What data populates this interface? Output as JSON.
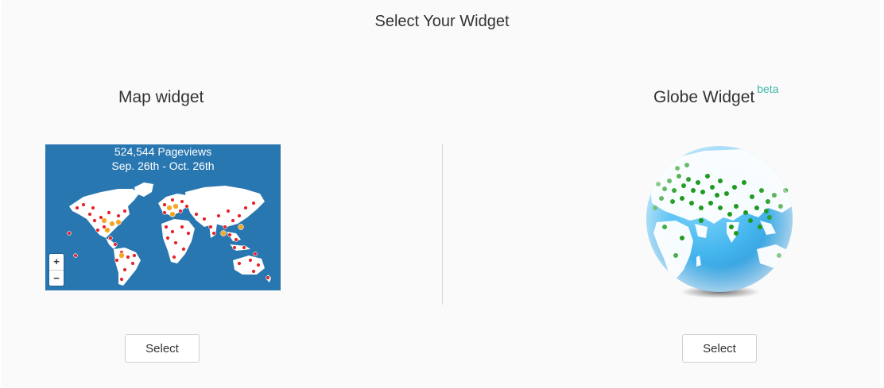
{
  "page": {
    "title": "Select Your Widget"
  },
  "map_widget": {
    "title": "Map widget",
    "stats_line1": "524,544 Pageviews",
    "stats_line2": "Sep. 26th - Oct. 26th",
    "zoom_in": "+",
    "zoom_out": "−",
    "select_label": "Select",
    "colors": {
      "ocean": "#2977b0",
      "land": "#ffffff",
      "dot_low": "#e8232a",
      "dot_high": "#f5a623"
    }
  },
  "globe_widget": {
    "title": "Globe Widget",
    "badge": "beta",
    "select_label": "Select",
    "colors": {
      "ocean": "#5cc4f2",
      "land": "#ffffff",
      "dot": "#1f9a1f",
      "badge": "#3fb6a8"
    }
  }
}
